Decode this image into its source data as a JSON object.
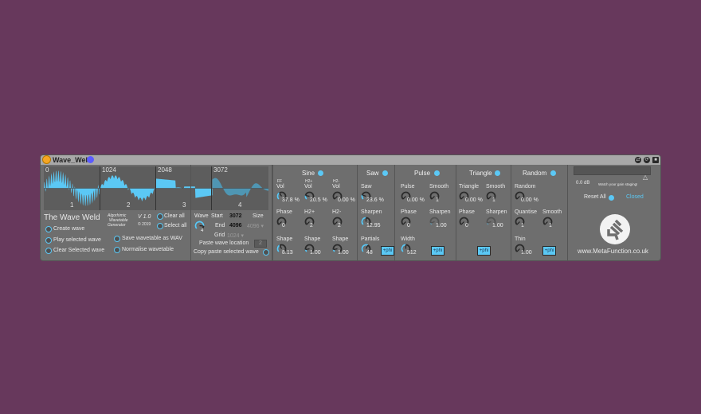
{
  "device": {
    "title": "Wave_Weld",
    "title_buttons": [
      "hot-swap",
      "preset",
      "save"
    ]
  },
  "wavetable": {
    "segments": [
      {
        "offset": "0",
        "index": "1",
        "selected": false
      },
      {
        "offset": "1024",
        "index": "2",
        "selected": false
      },
      {
        "offset": "2048",
        "index": "3",
        "selected": false
      },
      {
        "offset": "3072",
        "index": "4",
        "selected": true
      }
    ],
    "wave_color": "#5bc8f5"
  },
  "info": {
    "product_name": "The Wave Weld",
    "tagline_1": "Algorhimic",
    "tagline_2": "Wavetable",
    "tagline_3": "Generator",
    "version": "V 1.0",
    "year": "© 2019",
    "clear_all": "Clear all",
    "select_all": "Select all",
    "create_wave": "Create wave",
    "play_selected": "Play selected wave",
    "clear_selected": "Clear Selected wave",
    "save_wav": "Save wavetable as WAV",
    "normalise": "Normalise wavetable"
  },
  "position": {
    "wave_label": "Wave",
    "wave_value": "4",
    "start_label": "Start",
    "start_value": "3072",
    "end_label": "End",
    "end_value": "4096",
    "size_label": "Size",
    "size_value": "4096",
    "grid_label": "Grid",
    "grid_value": "1024",
    "paste_location_label": "Paste wave location",
    "paste_location_value": "2",
    "copy_paste_label": "Copy paste selected wave"
  },
  "sine": {
    "header": "Sine",
    "ff_label": "FF",
    "h2p_label": "H2+",
    "h2m_label": "H2-",
    "vol_label": "Vol",
    "vol_ff": "37.8 %",
    "vol_h2p": "20.5 %",
    "vol_h2m": "0.00 %",
    "phase_label": "Phase",
    "phase_value": "0",
    "h2p_knob_label": "H2+",
    "h2p_value": "2",
    "h2m_knob_label": "H2-",
    "h2m_value": "2",
    "shape_label": "Shape",
    "shape_ff": "8.13",
    "shape_h2p": "1.00",
    "shape_h2m": "1.00"
  },
  "saw": {
    "header": "Saw",
    "saw_label": "Saw",
    "saw_value": "23.6 %",
    "sharpen_label": "Sharpen",
    "sharpen_value": "12.95",
    "partials_label": "Partials",
    "partials_value": "48",
    "phi_label": "+phi"
  },
  "pulse": {
    "header": "Pulse",
    "pulse_label": "Pulse",
    "pulse_value": "0.00 %",
    "smooth_label": "Smooth",
    "smooth_value": "1",
    "phase_label": "Phase",
    "phase_value": "0",
    "sharpen_label": "Sharpen",
    "sharpen_value": "1.00",
    "width_label": "Width",
    "width_value": "512",
    "phi_label": "+phi"
  },
  "triangle": {
    "header": "Triangle",
    "triangle_label": "Triangle",
    "triangle_value": "0.00 %",
    "smooth_label": "Smooth",
    "smooth_value": "1",
    "phase_label": "Phase",
    "phase_value": "0",
    "sharpen_label": "Sharpen",
    "sharpen_value": "1.00",
    "phi_label": "+phi"
  },
  "random": {
    "header": "Random",
    "random_label": "Random",
    "random_value": "0.00 %",
    "quantise_label": "Quantise",
    "quantise_value": "1",
    "smooth_label": "Smooth",
    "smooth_value": "1",
    "thin_label": "Thin",
    "thin_value": "1.00",
    "phi_label": "+phi"
  },
  "output": {
    "db_value": "0.0 dB",
    "gain_hint": "Watch your gain staging!",
    "reset_label": "Reset All",
    "state_label": "Closed",
    "website": "www.MetaFunction.co.uk",
    "accent": "#5bc8f5"
  }
}
